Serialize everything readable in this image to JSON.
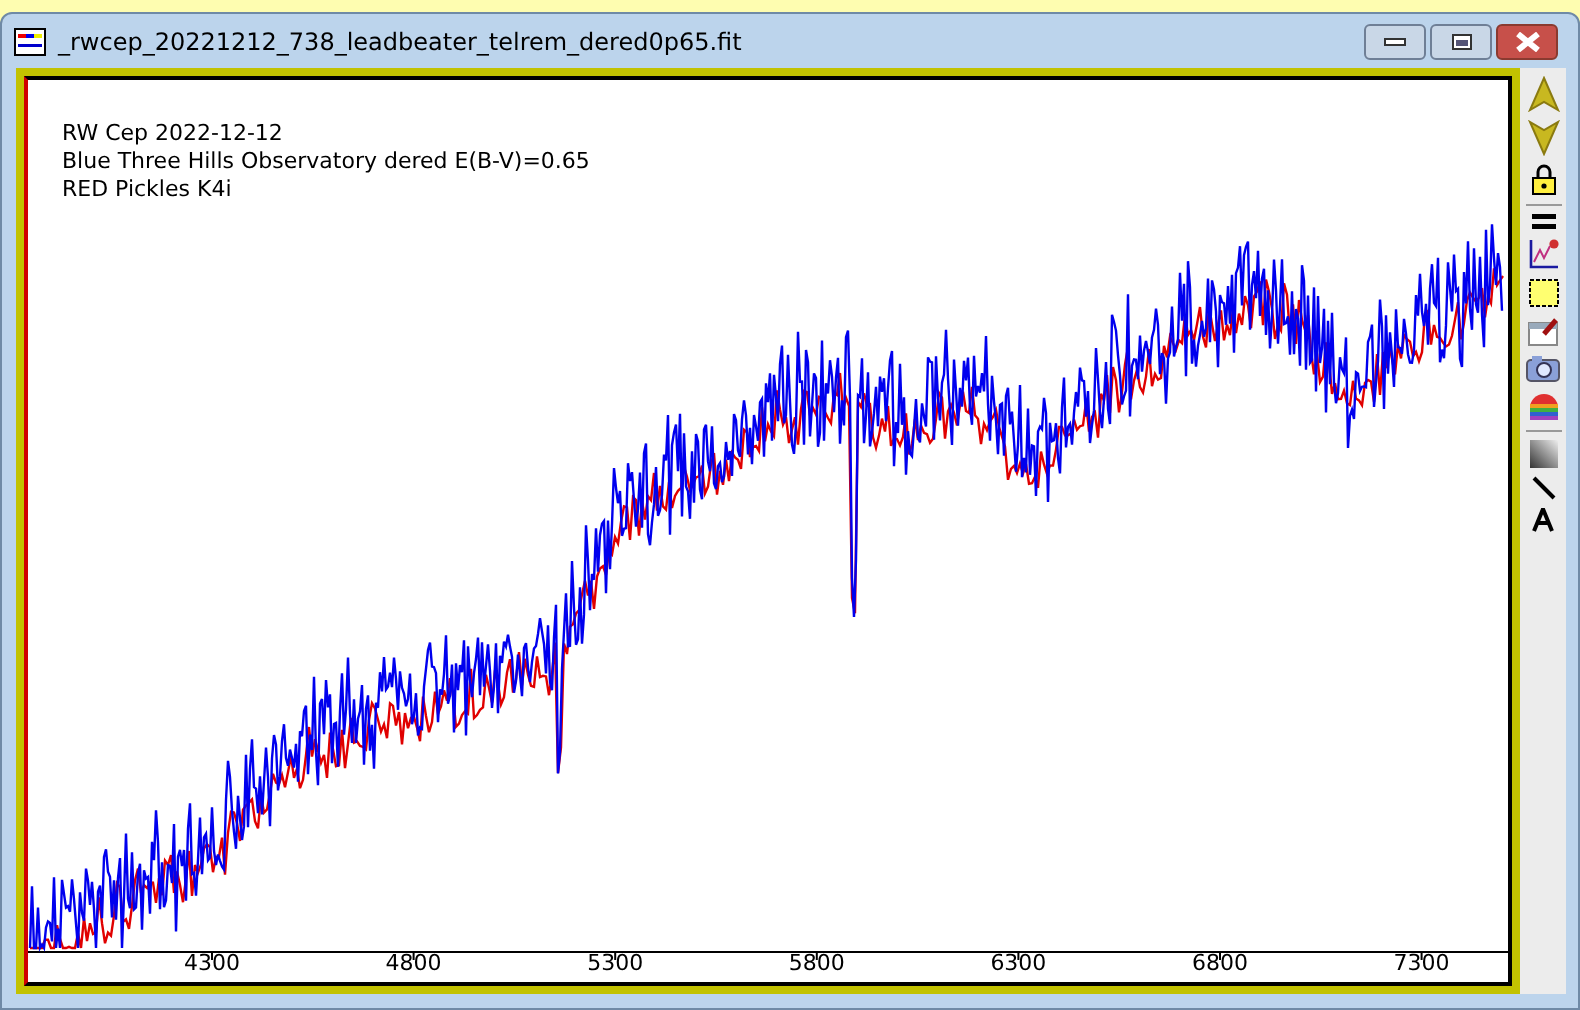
{
  "window": {
    "title": "_rwcep_20221212_738_leadbeater_telrem_dered0p65.fit"
  },
  "plot": {
    "legend": [
      "RW Cep 2022-12-12",
      "Blue Three Hills Observatory dered E(B-V)=0.65",
      "RED Pickles K4i"
    ],
    "x_ticks": [
      "4300",
      "4800",
      "5300",
      "5800",
      "6300",
      "6800",
      "7300"
    ]
  }
}
